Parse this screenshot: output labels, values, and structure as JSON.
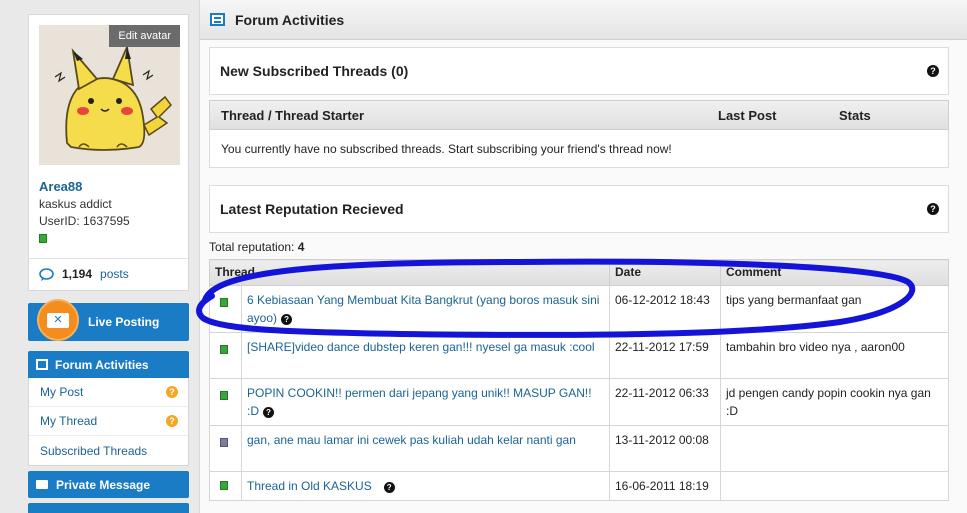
{
  "profile": {
    "edit_avatar": "Edit avatar",
    "username": "Area88",
    "rank": "kaskus addict",
    "user_id": "UserID: 1637595",
    "post_count": "1,194",
    "posts_label": "posts"
  },
  "sidebar": {
    "live_posting": "Live Posting",
    "forum_activities": "Forum Activities",
    "items": [
      {
        "label": "My Post",
        "badge": "?"
      },
      {
        "label": "My Thread",
        "badge": "?"
      },
      {
        "label": "Subscribed Threads",
        "badge": ""
      }
    ],
    "private_message": "Private Message"
  },
  "main": {
    "header_title": "Forum Activities",
    "subscribed": {
      "title": "New Subscribed Threads (0)",
      "help": "?",
      "columns": [
        "Thread / Thread Starter",
        "Last Post",
        "Stats"
      ],
      "empty_message": "You currently have no subscribed threads. Start subscribing your friend's thread now!"
    },
    "reputation": {
      "title": "Latest Reputation Recieved",
      "help": "?",
      "total_label": "Total reputation:",
      "total_value": "4",
      "columns": [
        "Thread",
        "Date",
        "Comment"
      ],
      "rows": [
        {
          "status": "green",
          "thread": "6 Kebiasaan Yang Membuat Kita Bangkrut (yang boros masuk sini ayoo)",
          "date": "06-12-2012 18:43",
          "comment": "tips yang bermanfaat gan"
        },
        {
          "status": "green",
          "thread": "[SHARE]video dance dubstep keren gan!!! nyesel ga masuk :cool",
          "date": "22-11-2012 17:59",
          "comment": "tambahin bro video nya , aaron00"
        },
        {
          "status": "green",
          "thread": "POPIN COOKIN!! permen dari jepang yang unik!! MASUP GAN!! :D",
          "date": "22-11-2012 06:33",
          "comment": "jd pengen candy popin cookin nya gan :D"
        },
        {
          "status": "grey",
          "thread": "gan, ane mau lamar ini cewek pas kuliah udah kelar nanti gan",
          "date": "13-11-2012 00:08",
          "comment": ""
        },
        {
          "status": "green",
          "thread": "Thread in Old KASKUS",
          "date": "16-06-2011 18:19",
          "comment": ""
        }
      ]
    }
  },
  "colors": {
    "accent": "#1a7cc4",
    "link": "#1a6496",
    "scribble": "#1414d8",
    "orange": "#f48c1e"
  }
}
